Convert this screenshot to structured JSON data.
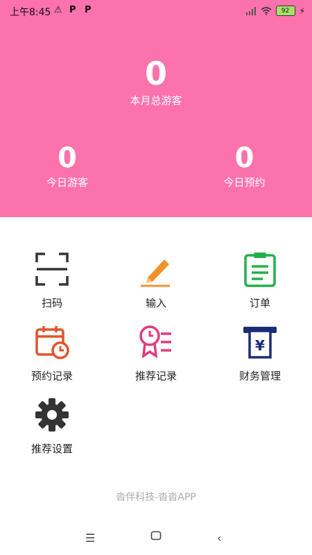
{
  "status_bar": {
    "time": "上午8:45",
    "battery": "92"
  },
  "stats": {
    "monthly_visitors": {
      "value": "0",
      "label": "本月总游客"
    },
    "today_visitors": {
      "value": "0",
      "label": "今日游客"
    },
    "today_bookings": {
      "value": "0",
      "label": "今日预约"
    }
  },
  "menu": [
    {
      "label": "扫码",
      "icon": "scan-icon"
    },
    {
      "label": "输入",
      "icon": "pencil-icon"
    },
    {
      "label": "订单",
      "icon": "clipboard-icon"
    },
    {
      "label": "预约记录",
      "icon": "calendar-clock-icon"
    },
    {
      "label": "推荐记录",
      "icon": "badge-list-icon"
    },
    {
      "label": "财务管理",
      "icon": "yen-receipt-icon"
    },
    {
      "label": "推荐设置",
      "icon": "gear-icon"
    }
  ],
  "footer": "沓伴科技-沓沓APP",
  "colors": {
    "header_bg": "#fc72ac",
    "orange": "#f0932b",
    "green": "#22b04b",
    "red": "#e0552c",
    "pink": "#e23a7e",
    "navy": "#1b2a78",
    "dark": "#333333"
  }
}
